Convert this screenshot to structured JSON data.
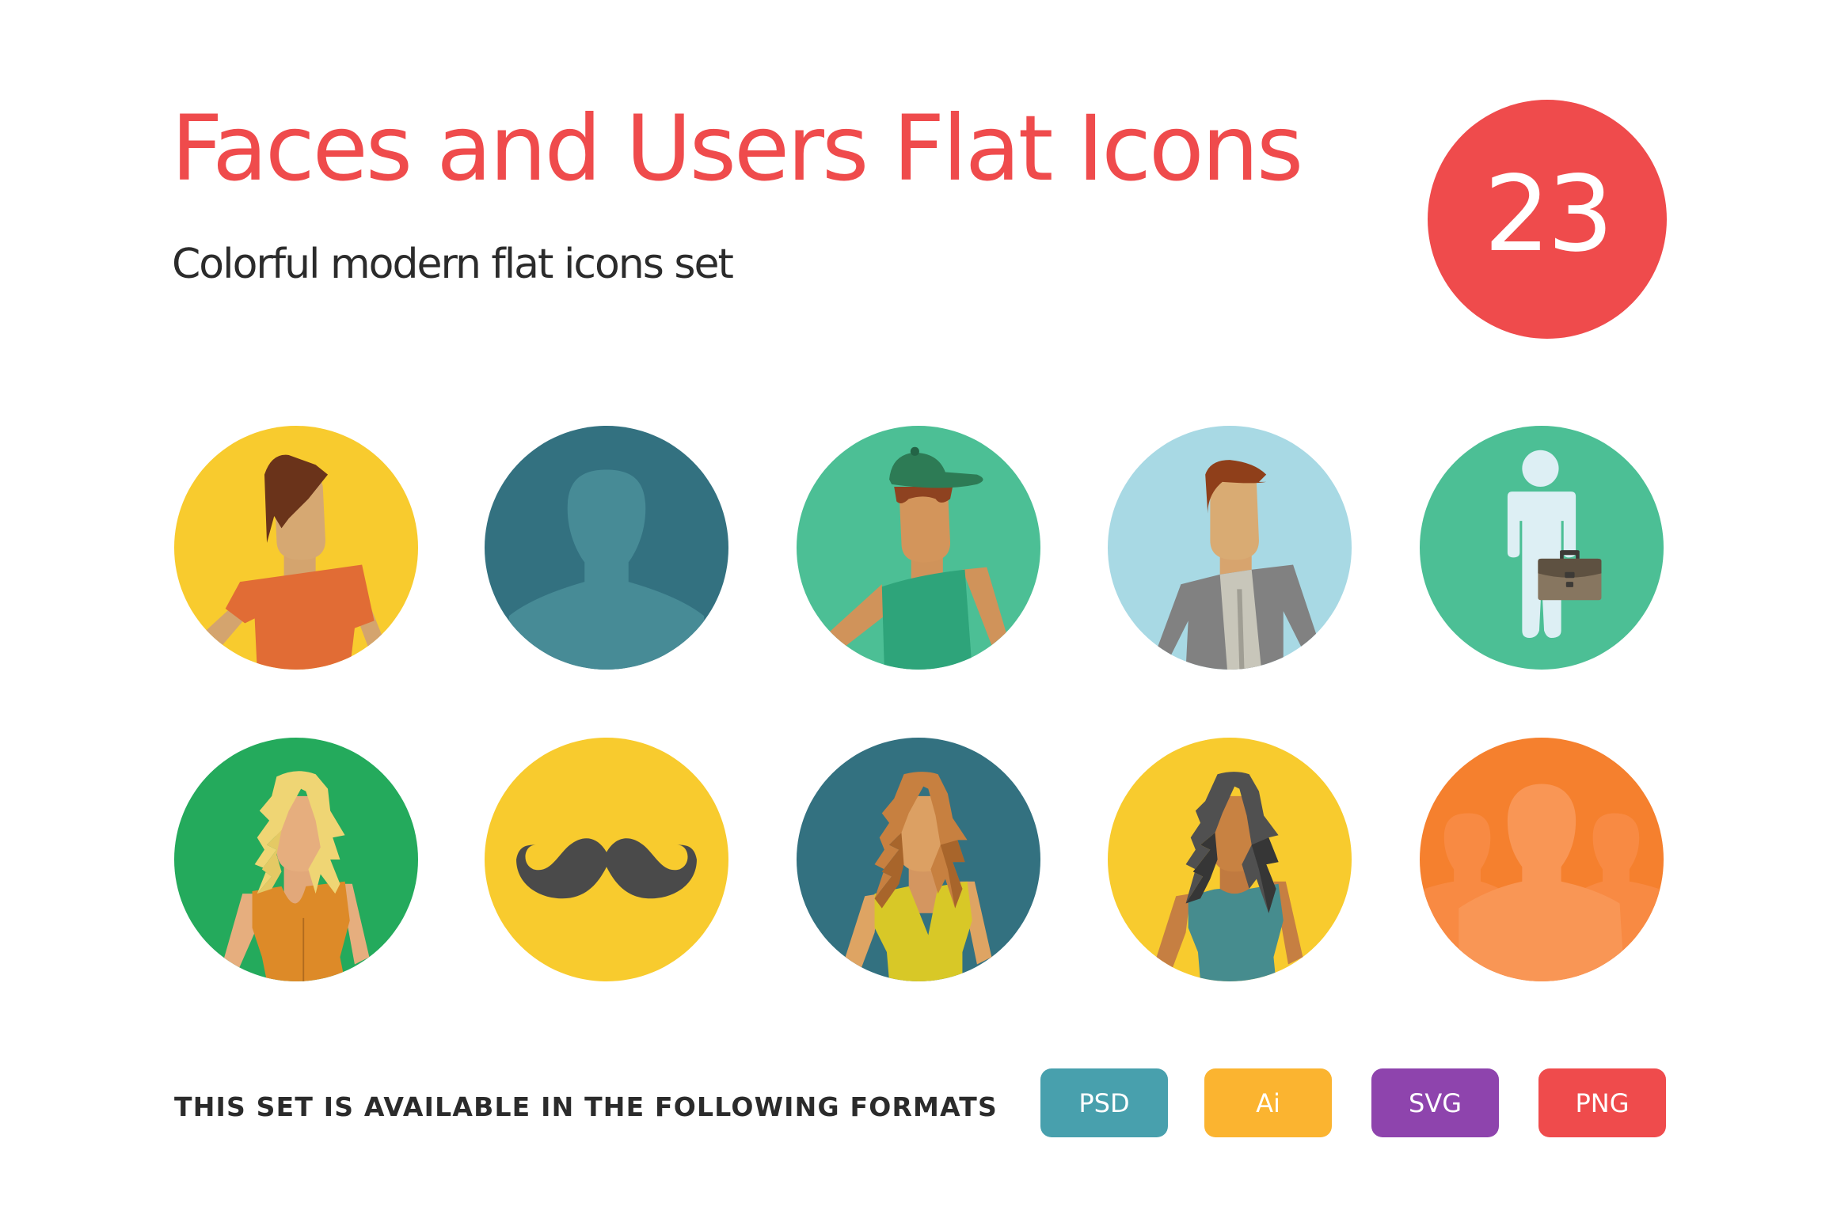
{
  "header": {
    "title": "Faces and Users Flat Icons",
    "title_color": "#EF4B4C",
    "subtitle": "Colorful modern flat icons  set",
    "icon_count": "23",
    "badge_color": "#EF4B4C"
  },
  "icons": [
    {
      "name": "man-brown-hair-orange-shirt",
      "bg": "#F8CB2E"
    },
    {
      "name": "default-user-silhouette",
      "bg": "#337180"
    },
    {
      "name": "man-green-cap",
      "bg": "#4CBF95"
    },
    {
      "name": "businessman-grey-jacket",
      "bg": "#A8D9E4"
    },
    {
      "name": "man-with-briefcase",
      "bg": "#4CBF95"
    },
    {
      "name": "woman-blonde-hair",
      "bg": "#24AA5C"
    },
    {
      "name": "mustache",
      "bg": "#F8CB2E"
    },
    {
      "name": "woman-auburn-hair",
      "bg": "#337180"
    },
    {
      "name": "woman-dark-hair",
      "bg": "#F8CB2E"
    },
    {
      "name": "user-group",
      "bg": "#F5802E"
    }
  ],
  "footer": {
    "formats_label": "THIS SET IS AVAILABLE IN THE FOLLOWING FORMATS",
    "formats": [
      {
        "label": "PSD",
        "color": "#48A0AD"
      },
      {
        "label": "Ai",
        "color": "#FBB430"
      },
      {
        "label": "SVG",
        "color": "#8E44AD"
      },
      {
        "label": "PNG",
        "color": "#EF4B4C"
      }
    ]
  }
}
